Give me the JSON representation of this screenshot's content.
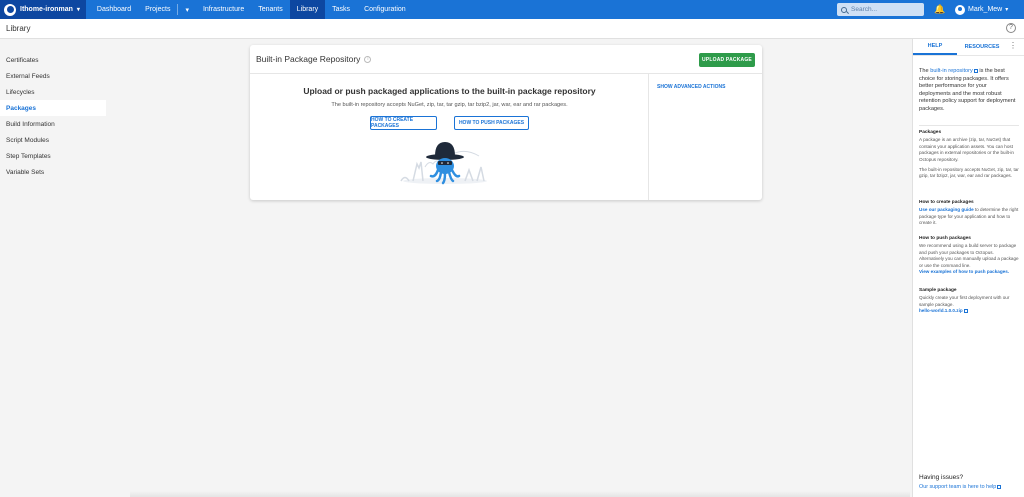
{
  "topnav": {
    "space_name": "Ithome-ironman",
    "links": [
      "Dashboard",
      "Projects",
      "Infrastructure",
      "Tenants",
      "Library",
      "Tasks",
      "Configuration"
    ],
    "active": "Library",
    "search_placeholder": "Search...",
    "user_name": "Mark_Mew"
  },
  "page": {
    "title": "Library"
  },
  "sidebar": {
    "items": [
      "Certificates",
      "External Feeds",
      "Lifecycles",
      "Packages",
      "Build Information",
      "Script Modules",
      "Step Templates",
      "Variable Sets"
    ],
    "active": "Packages"
  },
  "card": {
    "title": "Built-in Package Repository",
    "upload_label": "UPLOAD PACKAGE",
    "headline": "Upload or push packaged applications to the built-in package repository",
    "description": "The built-in repository accepts NuGet, zip, tar, tar gzip, tar bzip2, jar, war, ear and rar packages.",
    "how_create": "HOW TO CREATE PACKAGES",
    "how_push": "HOW TO PUSH PACKAGES",
    "advanced": "SHOW ADVANCED ACTIONS"
  },
  "help": {
    "tabs": [
      "HELP",
      "RESOURCES"
    ],
    "intro_pre": "The ",
    "intro_link": "built-in repository",
    "intro_post": " is the best choice for storing packages. It offers better performance for your deployments and the most robust retention policy support for deployment packages.",
    "sections": [
      {
        "title": "Packages",
        "body": "A package is an archive (zip, tar, NuGet) that contains your application assets. You can host packages in external repositories or the built-in Octopus repository.",
        "body2": "The built-in repository accepts NuGet, zip, tar, tar gzip, tar bzip2, jar, war, ear and rar packages."
      },
      {
        "title": "How to create packages",
        "link": "Use our packaging guide",
        "body": " to determine the right package type for your application and how to create it."
      },
      {
        "title": "How to push packages",
        "body": "We recommend using a build server to package and push your packages to Octopus. Alternatively you can manually upload a package or use the command line.",
        "link": "View examples of how to push packages."
      },
      {
        "title": "Sample package",
        "body": "Quickly create your first deployment with our sample package.",
        "link": "hello-world.1.0.0.zip"
      }
    ],
    "issues_title": "Having issues?",
    "issues_link": "Our support team is here to help"
  },
  "colors": {
    "nav": "#1a73d6",
    "nav_active": "#0d47a1",
    "accent": "#1a73d6",
    "upload": "#2e9b4a"
  },
  "icons": [
    "space-logo-icon",
    "caret-down-icon",
    "search-icon",
    "bell-icon",
    "avatar-icon",
    "help-circle-icon",
    "info-icon",
    "kebab-icon",
    "external-link-icon",
    "octopus-mascot-icon"
  ]
}
